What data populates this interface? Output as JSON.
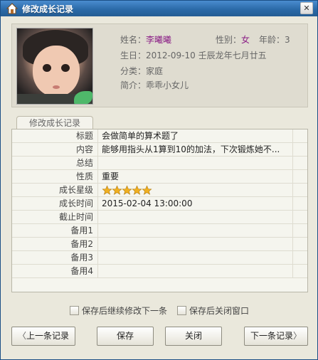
{
  "window": {
    "title": "修改成长记录",
    "close_symbol": "✕"
  },
  "profile": {
    "name_label": "姓名：",
    "name": "李曦曦",
    "gender_label": "性别：",
    "gender": "女",
    "age_label": "年龄：",
    "age": "3",
    "birthday_label": "生日：",
    "birthday": "2012-09-10 壬辰龙年七月廿五",
    "category_label": "分类：",
    "category": "家庭",
    "intro_label": "简介：",
    "intro": "乖乖小女儿"
  },
  "tab": {
    "label": "修改成长记录"
  },
  "grid": {
    "rows": [
      {
        "label": "标题",
        "value": "会做简单的算术题了"
      },
      {
        "label": "内容",
        "value": "能够用指头从1算到10的加法，下次锻炼她不..."
      },
      {
        "label": "总结",
        "value": ""
      },
      {
        "label": "性质",
        "value": "重要"
      },
      {
        "label": "成长星级",
        "value": ""
      },
      {
        "label": "成长时间",
        "value": "2015-02-04 13:00:00"
      },
      {
        "label": "截止时间",
        "value": ""
      },
      {
        "label": "备用1",
        "value": ""
      },
      {
        "label": "备用2",
        "value": ""
      },
      {
        "label": "备用3",
        "value": ""
      },
      {
        "label": "备用4",
        "value": ""
      }
    ],
    "star_rating": 5,
    "star_color": "#f0b020"
  },
  "options": {
    "continue_edit": "保存后继续修改下一条",
    "close_after_save": "保存后关闭窗口"
  },
  "buttons": {
    "prev": "上一条记录",
    "save": "保存",
    "close": "关闭",
    "next": "下一条记录",
    "prev_arrow": "〈",
    "next_arrow": "〉"
  },
  "colors": {
    "titlebar": "#2b6aa8",
    "window_bg": "#eae8dc",
    "accent_name": "#8b1f86"
  }
}
